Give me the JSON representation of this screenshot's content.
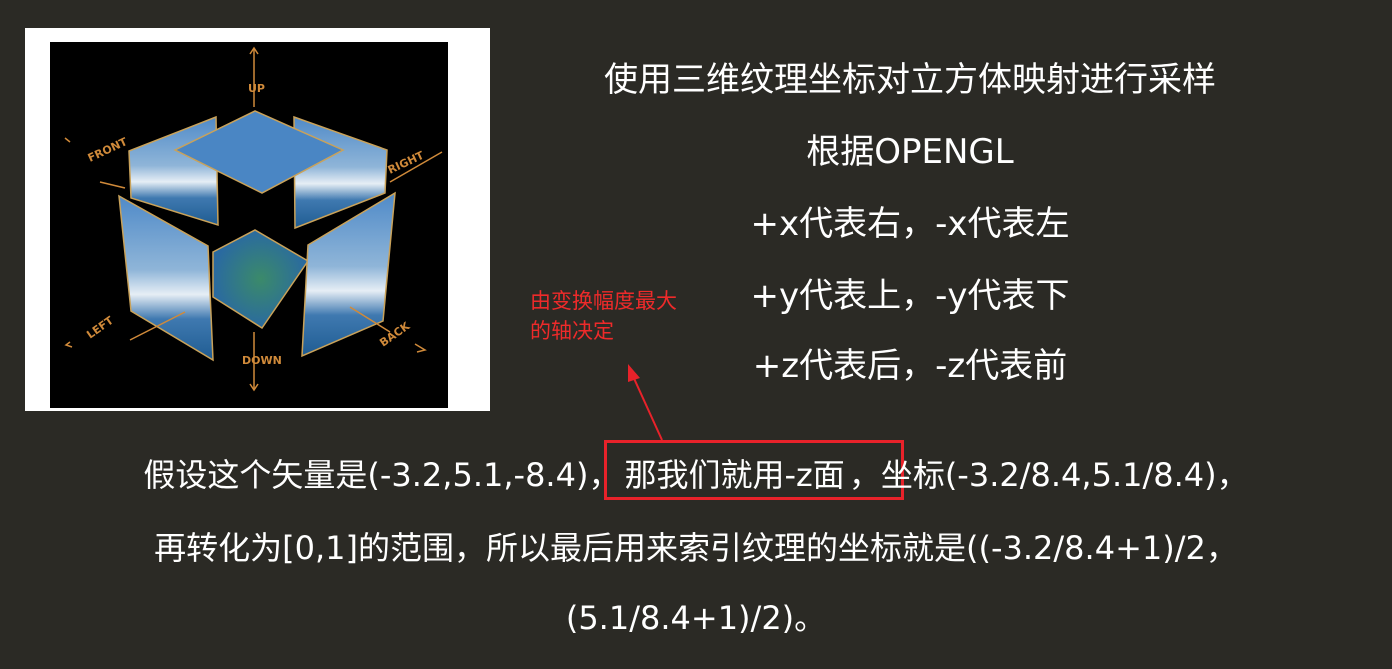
{
  "figure": {
    "labels": {
      "up": "UP",
      "down": "DOWN",
      "front": "FRONT",
      "back": "BACK",
      "left": "LEFT",
      "right": "RIGHT"
    },
    "colors": {
      "label": "#d08a3a",
      "sky": "#4a86c4",
      "edge": "#c9a25a"
    }
  },
  "heading": {
    "line1": "使用三维纹理坐标对立方体映射进行采样",
    "line2": "根据OPENGL",
    "line3": "+x代表右，-x代表左",
    "line4": "+y代表上，-y代表下",
    "line5": "+z代表后，-z代表前"
  },
  "annotation": {
    "line1": "由变换幅度最大",
    "line2": "的轴决定",
    "color": "#ee2a2a"
  },
  "body": {
    "p1_a": "假设这个矢量是(-3.2,5.1,-8.4)，",
    "p1_highlight": "那我们就用-z面",
    "p1_b": "，坐标(-3.2/8.4,5.1/8.4)，",
    "p2": "再转化为[0,1]的范围，所以最后用来索引纹理的坐标就是((-3.2/8.4+1)/2，",
    "p3": "(5.1/8.4+1)/2)。"
  }
}
